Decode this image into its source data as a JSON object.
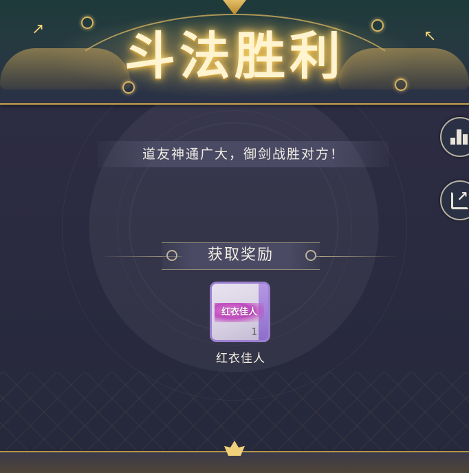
{
  "header": {
    "title": "斗法胜利"
  },
  "message": "道友神通广大，御剑战胜对方！",
  "reward": {
    "heading": "获取奖励",
    "items": [
      {
        "icon_text": "红衣佳人",
        "count": "1",
        "name": "红衣佳人"
      }
    ]
  },
  "side_buttons": [
    {
      "icon": "bar-chart-icon"
    },
    {
      "icon": "share-icon"
    }
  ],
  "colors": {
    "title_gold": "#fff4cf",
    "accent_gold": "#c9a24d",
    "panel_bg": "#2a2940",
    "item_border": "#9b7fd0"
  }
}
